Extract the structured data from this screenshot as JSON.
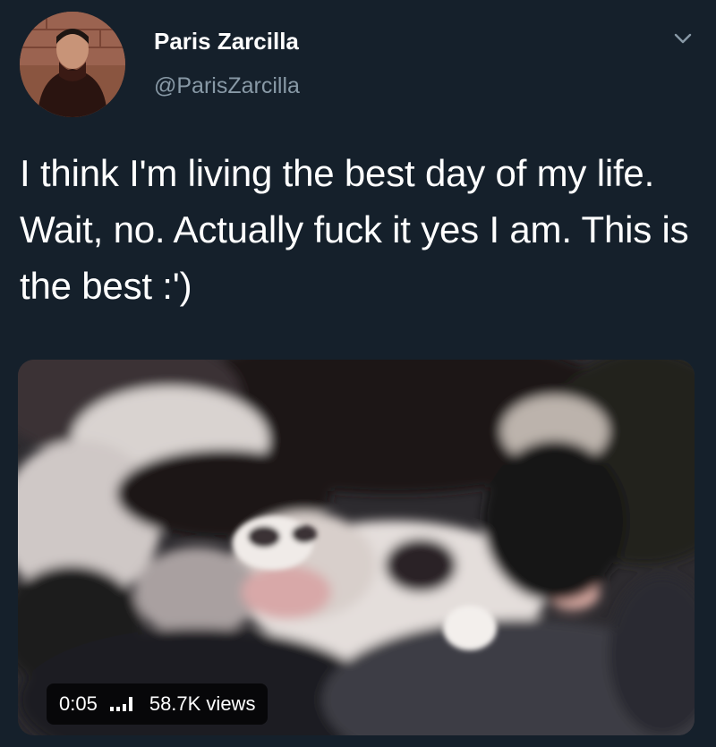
{
  "tweet": {
    "display_name": "Paris Zarcilla",
    "handle": "@ParisZarcilla",
    "text": "I think I'm living the best day of my life. Wait, no. Actually fuck it yes I am. This is the best :')",
    "icons": {
      "menu": "chevron-down-icon",
      "volume": "signal-bars-icon"
    }
  },
  "video": {
    "elapsed": "0:05",
    "views": "58.7K views"
  }
}
